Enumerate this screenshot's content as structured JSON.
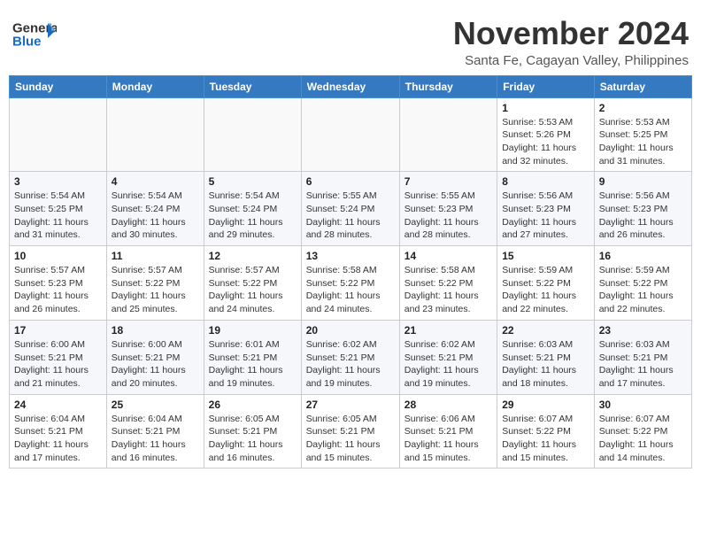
{
  "header": {
    "logo_line1": "General",
    "logo_line2": "Blue",
    "month": "November 2024",
    "location": "Santa Fe, Cagayan Valley, Philippines"
  },
  "days_of_week": [
    "Sunday",
    "Monday",
    "Tuesday",
    "Wednesday",
    "Thursday",
    "Friday",
    "Saturday"
  ],
  "weeks": [
    [
      {
        "day": "",
        "info": ""
      },
      {
        "day": "",
        "info": ""
      },
      {
        "day": "",
        "info": ""
      },
      {
        "day": "",
        "info": ""
      },
      {
        "day": "",
        "info": ""
      },
      {
        "day": "1",
        "info": "Sunrise: 5:53 AM\nSunset: 5:26 PM\nDaylight: 11 hours\nand 32 minutes."
      },
      {
        "day": "2",
        "info": "Sunrise: 5:53 AM\nSunset: 5:25 PM\nDaylight: 11 hours\nand 31 minutes."
      }
    ],
    [
      {
        "day": "3",
        "info": "Sunrise: 5:54 AM\nSunset: 5:25 PM\nDaylight: 11 hours\nand 31 minutes."
      },
      {
        "day": "4",
        "info": "Sunrise: 5:54 AM\nSunset: 5:24 PM\nDaylight: 11 hours\nand 30 minutes."
      },
      {
        "day": "5",
        "info": "Sunrise: 5:54 AM\nSunset: 5:24 PM\nDaylight: 11 hours\nand 29 minutes."
      },
      {
        "day": "6",
        "info": "Sunrise: 5:55 AM\nSunset: 5:24 PM\nDaylight: 11 hours\nand 28 minutes."
      },
      {
        "day": "7",
        "info": "Sunrise: 5:55 AM\nSunset: 5:23 PM\nDaylight: 11 hours\nand 28 minutes."
      },
      {
        "day": "8",
        "info": "Sunrise: 5:56 AM\nSunset: 5:23 PM\nDaylight: 11 hours\nand 27 minutes."
      },
      {
        "day": "9",
        "info": "Sunrise: 5:56 AM\nSunset: 5:23 PM\nDaylight: 11 hours\nand 26 minutes."
      }
    ],
    [
      {
        "day": "10",
        "info": "Sunrise: 5:57 AM\nSunset: 5:23 PM\nDaylight: 11 hours\nand 26 minutes."
      },
      {
        "day": "11",
        "info": "Sunrise: 5:57 AM\nSunset: 5:22 PM\nDaylight: 11 hours\nand 25 minutes."
      },
      {
        "day": "12",
        "info": "Sunrise: 5:57 AM\nSunset: 5:22 PM\nDaylight: 11 hours\nand 24 minutes."
      },
      {
        "day": "13",
        "info": "Sunrise: 5:58 AM\nSunset: 5:22 PM\nDaylight: 11 hours\nand 24 minutes."
      },
      {
        "day": "14",
        "info": "Sunrise: 5:58 AM\nSunset: 5:22 PM\nDaylight: 11 hours\nand 23 minutes."
      },
      {
        "day": "15",
        "info": "Sunrise: 5:59 AM\nSunset: 5:22 PM\nDaylight: 11 hours\nand 22 minutes."
      },
      {
        "day": "16",
        "info": "Sunrise: 5:59 AM\nSunset: 5:22 PM\nDaylight: 11 hours\nand 22 minutes."
      }
    ],
    [
      {
        "day": "17",
        "info": "Sunrise: 6:00 AM\nSunset: 5:21 PM\nDaylight: 11 hours\nand 21 minutes."
      },
      {
        "day": "18",
        "info": "Sunrise: 6:00 AM\nSunset: 5:21 PM\nDaylight: 11 hours\nand 20 minutes."
      },
      {
        "day": "19",
        "info": "Sunrise: 6:01 AM\nSunset: 5:21 PM\nDaylight: 11 hours\nand 19 minutes."
      },
      {
        "day": "20",
        "info": "Sunrise: 6:02 AM\nSunset: 5:21 PM\nDaylight: 11 hours\nand 19 minutes."
      },
      {
        "day": "21",
        "info": "Sunrise: 6:02 AM\nSunset: 5:21 PM\nDaylight: 11 hours\nand 19 minutes."
      },
      {
        "day": "22",
        "info": "Sunrise: 6:03 AM\nSunset: 5:21 PM\nDaylight: 11 hours\nand 18 minutes."
      },
      {
        "day": "23",
        "info": "Sunrise: 6:03 AM\nSunset: 5:21 PM\nDaylight: 11 hours\nand 17 minutes."
      }
    ],
    [
      {
        "day": "24",
        "info": "Sunrise: 6:04 AM\nSunset: 5:21 PM\nDaylight: 11 hours\nand 17 minutes."
      },
      {
        "day": "25",
        "info": "Sunrise: 6:04 AM\nSunset: 5:21 PM\nDaylight: 11 hours\nand 16 minutes."
      },
      {
        "day": "26",
        "info": "Sunrise: 6:05 AM\nSunset: 5:21 PM\nDaylight: 11 hours\nand 16 minutes."
      },
      {
        "day": "27",
        "info": "Sunrise: 6:05 AM\nSunset: 5:21 PM\nDaylight: 11 hours\nand 15 minutes."
      },
      {
        "day": "28",
        "info": "Sunrise: 6:06 AM\nSunset: 5:21 PM\nDaylight: 11 hours\nand 15 minutes."
      },
      {
        "day": "29",
        "info": "Sunrise: 6:07 AM\nSunset: 5:22 PM\nDaylight: 11 hours\nand 15 minutes."
      },
      {
        "day": "30",
        "info": "Sunrise: 6:07 AM\nSunset: 5:22 PM\nDaylight: 11 hours\nand 14 minutes."
      }
    ]
  ]
}
